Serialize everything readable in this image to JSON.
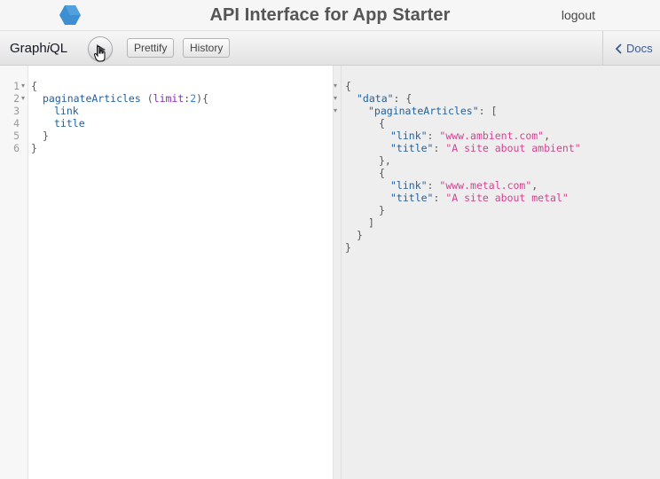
{
  "header": {
    "title": "API Interface for App Starter",
    "logout_label": "logout",
    "logo_icon": "hexagon-logo-icon",
    "logo_color": "#3d8fd1"
  },
  "toolbar": {
    "app_name_prefix": "Graph",
    "app_name_i": "i",
    "app_name_suffix": "QL",
    "run_icon": "play-icon",
    "prettify_label": "Prettify",
    "history_label": "History",
    "docs_label": "Docs",
    "docs_icon": "chevron-left-icon"
  },
  "query_editor": {
    "line_numbers": [
      "1",
      "2",
      "3",
      "4",
      "5",
      "6"
    ],
    "lines": [
      {
        "open": "{"
      },
      {
        "field": "paginateArticles",
        "lparen": " (",
        "arg": "limit",
        "colon": ":",
        "value": "2",
        "rparen": "){"
      },
      {
        "field": "link"
      },
      {
        "field": "title"
      },
      {
        "close": "}"
      },
      {
        "close": "}"
      }
    ]
  },
  "result_viewer": {
    "lines": [
      {
        "text": "{"
      },
      {
        "key": "\"data\"",
        "rest": ": {"
      },
      {
        "key": "\"paginateArticles\"",
        "rest": ": ["
      },
      {
        "text": "{"
      },
      {
        "key": "\"link\"",
        "sep": ": ",
        "value": "\"www.ambient.com\"",
        "tail": ","
      },
      {
        "key": "\"title\"",
        "sep": ": ",
        "value": "\"A site about ambient\""
      },
      {
        "text": "},"
      },
      {
        "text": "{"
      },
      {
        "key": "\"link\"",
        "sep": ": ",
        "value": "\"www.metal.com\"",
        "tail": ","
      },
      {
        "key": "\"title\"",
        "sep": ": ",
        "value": "\"A site about metal\""
      },
      {
        "text": "}"
      },
      {
        "text": "]"
      },
      {
        "text": "}"
      },
      {
        "text": "}"
      }
    ]
  },
  "colors": {
    "field": "#1F61A0",
    "argument": "#8B2BB9",
    "number": "#2882F9",
    "string": "#D64292",
    "docs_link": "#3B5998"
  }
}
